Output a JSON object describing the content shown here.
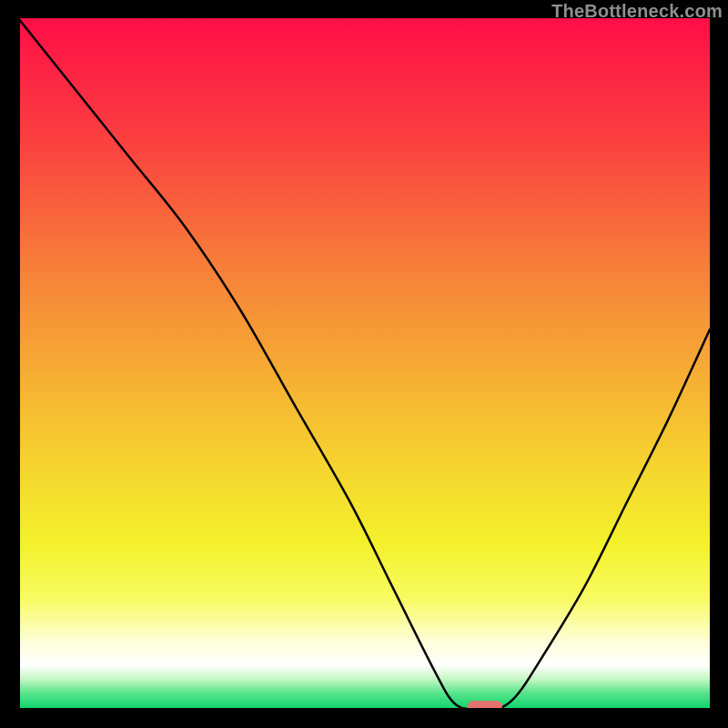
{
  "watermark": "TheBottleneck.com",
  "chart_data": {
    "type": "line",
    "title": "",
    "xlabel": "",
    "ylabel": "",
    "xlim": [
      0,
      100
    ],
    "ylim": [
      0,
      100
    ],
    "grid": false,
    "legend": false,
    "curve": {
      "name": "bottleneck-curve",
      "color": "#000000",
      "x": [
        0,
        8,
        16,
        24,
        32,
        40,
        48,
        54,
        60,
        63,
        66,
        69,
        72,
        76,
        82,
        88,
        94,
        100
      ],
      "y": [
        100,
        90,
        80,
        70,
        58,
        44,
        30,
        18,
        6,
        1,
        0,
        0,
        2,
        8,
        18,
        30,
        42,
        55
      ]
    },
    "marker": {
      "name": "optimal-marker",
      "shape": "rounded-rect",
      "color": "#e3736f",
      "cx": 67.5,
      "cy": 0.5,
      "width": 5,
      "height": 1.6
    },
    "background_gradient": {
      "type": "vertical",
      "stops": [
        {
          "offset": 0.0,
          "color": "#fe0e47"
        },
        {
          "offset": 0.18,
          "color": "#fb4140"
        },
        {
          "offset": 0.36,
          "color": "#f77f39"
        },
        {
          "offset": 0.5,
          "color": "#f6a934"
        },
        {
          "offset": 0.64,
          "color": "#f5d22f"
        },
        {
          "offset": 0.76,
          "color": "#f3f12b"
        },
        {
          "offset": 0.84,
          "color": "#f8fb62"
        },
        {
          "offset": 0.9,
          "color": "#fdfed6"
        },
        {
          "offset": 0.935,
          "color": "#ffffff"
        },
        {
          "offset": 0.955,
          "color": "#c7f7c4"
        },
        {
          "offset": 0.975,
          "color": "#5be58d"
        },
        {
          "offset": 1.0,
          "color": "#08d269"
        }
      ]
    }
  }
}
